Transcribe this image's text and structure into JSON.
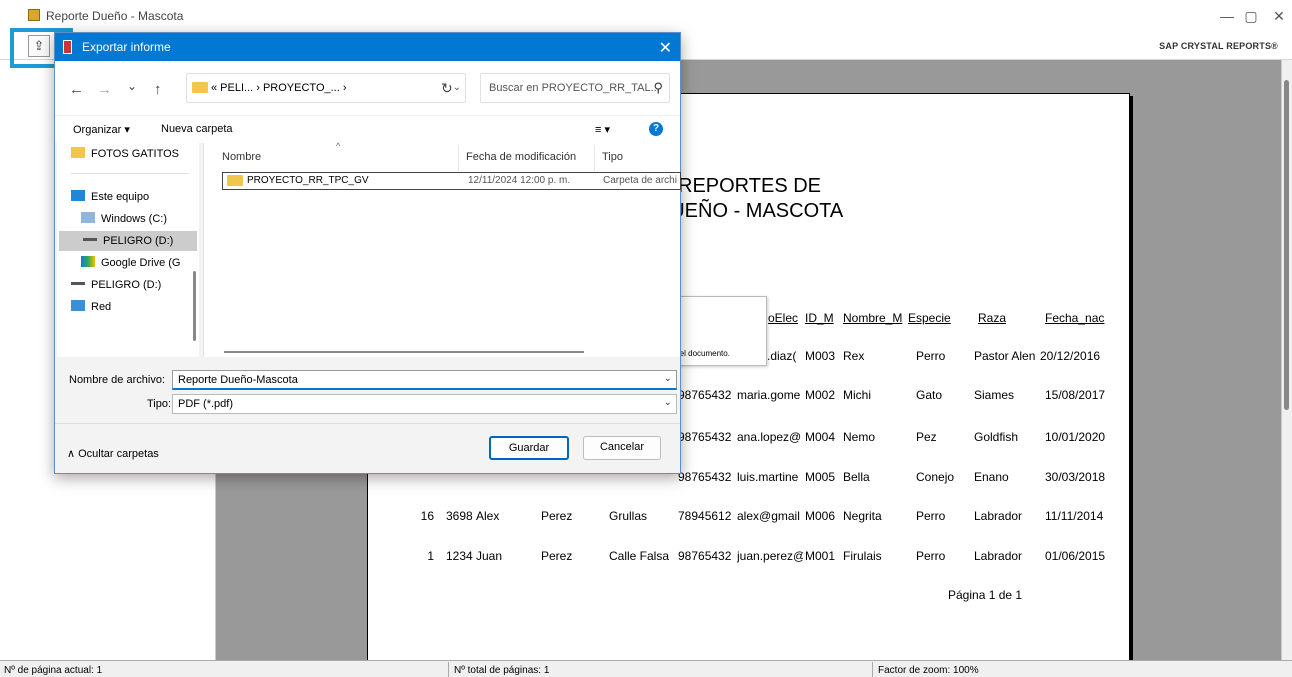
{
  "window": {
    "title": "Reporte Dueño - Mascota",
    "minimize_glyph": "—",
    "restore_glyph": "▢",
    "close_glyph": "✕"
  },
  "toolbar": {
    "brand": "SAP CRYSTAL REPORTS®",
    "export_icon": "export-icon",
    "print_icon": "print-icon"
  },
  "report": {
    "title_line1": "REPORTES DE",
    "title_line2": "DUEÑO - MASCOTA",
    "headers": [
      "oElec",
      "ID_M",
      "Nombre_M",
      "Especie",
      "Raza",
      "Fecha_nac"
    ],
    "rows": [
      {
        "c0": "",
        "c1": "",
        "c2": "",
        "c3": "",
        "c4": "",
        "c5": "s.diaz(",
        "c6": "M003",
        "c7": "Rex",
        "c8": "Perro",
        "c9": "Pastor Alen",
        "c10": "20/12/2016"
      },
      {
        "c0": "",
        "c1": "",
        "c2": "",
        "c3": "",
        "c4": "98765432",
        "c5": "maria.gome",
        "c6": "M002",
        "c7": "Michi",
        "c8": "Gato",
        "c9": "Siames",
        "c10": "15/08/2017"
      },
      {
        "c0": "",
        "c1": "",
        "c2": "",
        "c3": "",
        "c4": "98765432",
        "c5": "ana.lopez@",
        "c6": "M004",
        "c7": "Nemo",
        "c8": "Pez",
        "c9": "Goldfish",
        "c10": "10/01/2020"
      },
      {
        "c0": "",
        "c1": "",
        "c2": "",
        "c3": "",
        "c4": "98765432",
        "c5": "luis.martine",
        "c6": "M005",
        "c7": "Bella",
        "c8": "Conejo",
        "c9": "Enano",
        "c10": "30/03/2018"
      },
      {
        "c0": "16",
        "c1": "3698",
        "c2": "Alex",
        "c3": "Perez",
        "c3b": "Grullas",
        "c4": "78945612",
        "c5": "alex@gmail",
        "c6": "M006",
        "c7": "Negrita",
        "c8": "Perro",
        "c9": "Labrador",
        "c10": "11/11/2014"
      },
      {
        "c0": "1",
        "c1": "1234",
        "c2": "Juan",
        "c3": "Perez",
        "c3b": "Calle Falsa",
        "c4": "98765432",
        "c5": "juan.perez@",
        "c6": "M001",
        "c7": "Firulais",
        "c8": "Perro",
        "c9": "Labrador",
        "c10": "01/06/2015"
      }
    ],
    "page_footer": "Página 1 de 1",
    "tooltip_text": "sa el documento."
  },
  "status": {
    "current_page": "Nº de página actual: 1",
    "total_pages": "Nº total de páginas: 1",
    "zoom": "Factor de zoom: 100%"
  },
  "dialog": {
    "title": "Exportar informe",
    "close_glyph": "✕",
    "back_glyph": "←",
    "forward_glyph": "→",
    "recent_glyph": "⌄",
    "up_glyph": "↑",
    "address": "« PELI...  ›  PROYECTO_...  ›",
    "refresh_glyph": "↻",
    "search_placeholder": "Buscar en PROYECTO_RR_TAL...",
    "organize": "Organizar ▾",
    "new_folder": "Nueva carpeta",
    "view_glyph": "≡ ▾",
    "help_glyph": "?",
    "nav_items": [
      {
        "label": "FOTOS GATITOS",
        "icon": "folder-icon"
      },
      {
        "label": "Este equipo",
        "icon": "computer-icon"
      },
      {
        "label": "Windows (C:)",
        "icon": "drive-icon"
      },
      {
        "label": "PELIGRO (D:)",
        "icon": "drive-icon"
      },
      {
        "label": "Google Drive (G",
        "icon": "google-drive-icon"
      },
      {
        "label": "PELIGRO (D:)",
        "icon": "drive-icon"
      },
      {
        "label": "Red",
        "icon": "network-icon"
      }
    ],
    "columns": [
      "Nombre",
      "Fecha de modificación",
      "Tipo"
    ],
    "files": [
      {
        "name": "PROYECTO_RR_TPC_GV",
        "modified": "12/11/2024 12:00 p. m.",
        "type": "Carpeta de archi"
      }
    ],
    "filename_label": "Nombre de archivo:",
    "filename_value": "Reporte Dueño-Mascota",
    "type_label": "Tipo:",
    "type_value": "PDF (*.pdf)",
    "hide_folders": "∧  Ocultar carpetas",
    "save": "Guardar",
    "cancel": "Cancelar"
  }
}
